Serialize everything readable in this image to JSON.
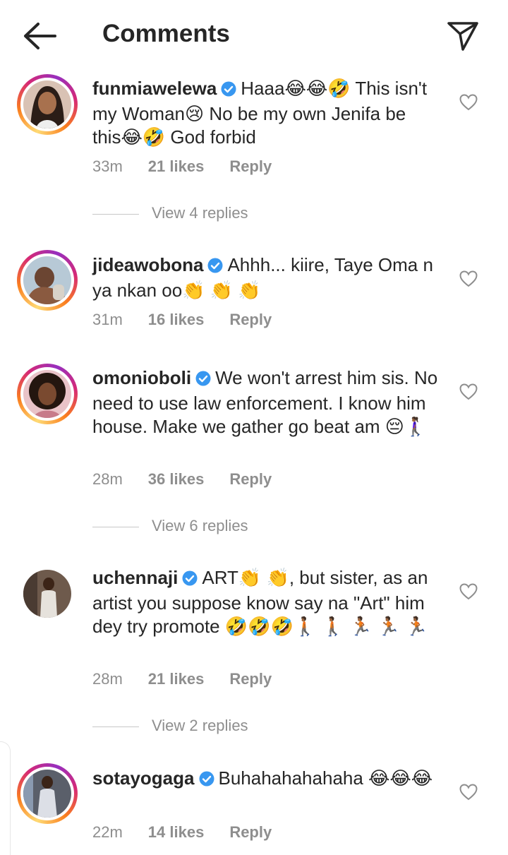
{
  "header": {
    "title": "Comments"
  },
  "comments": [
    {
      "username": "funmiawelewa",
      "text": "Haaa😂😂🤣 This isn't my Woman😢 No be my own Jenifa be this😂🤣 God forbid",
      "time": "33m",
      "likes": "21 likes",
      "reply": "Reply",
      "view_replies": "View 4 replies"
    },
    {
      "username": "jideawobona",
      "text": "Ahhh... kiire, Taye Oma n ya nkan oo👏 👏 👏",
      "time": "31m",
      "likes": "16 likes",
      "reply": "Reply"
    },
    {
      "username": "omonioboli",
      "text": "We won't arrest him sis. No need to use law enforcement. I know him house. Make we gather go beat am 😔🚶🏾‍♀️",
      "time": "28m",
      "likes": "36 likes",
      "reply": "Reply",
      "view_replies": "View 6 replies"
    },
    {
      "username": "uchennaji",
      "text": "ART👏 👏, but sister, as an artist you suppose know say na \"Art\" him dey try promote 🤣🤣🤣🚶🏾 🚶🏾 🏃🏾 🏃🏾 🏃🏾",
      "time": "28m",
      "likes": "21 likes",
      "reply": "Reply",
      "view_replies": "View 2 replies"
    },
    {
      "username": "sotayogaga",
      "text": "Buhahahahahaha 😂😂😂",
      "time": "22m",
      "likes": "14 likes",
      "reply": "Reply"
    }
  ]
}
